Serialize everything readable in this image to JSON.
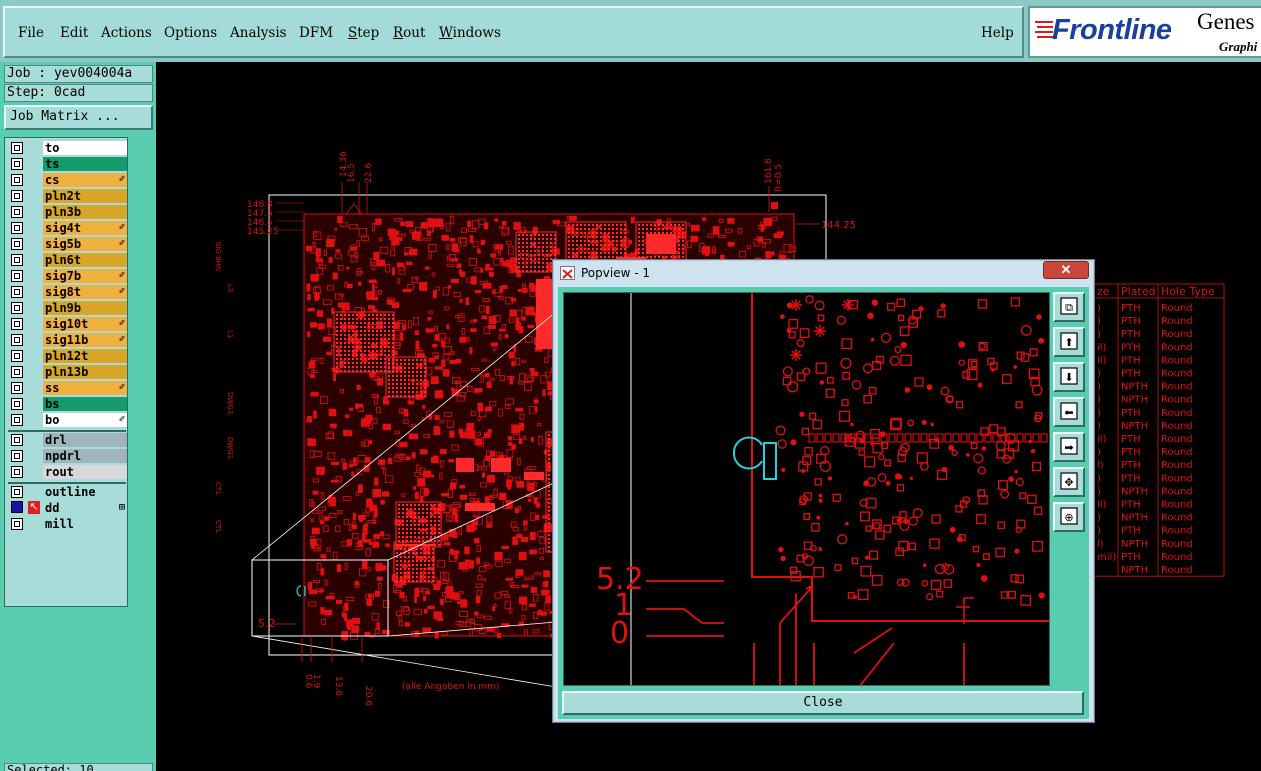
{
  "menubar": {
    "items": [
      "File",
      "Edit",
      "Actions",
      "Options",
      "Analysis",
      "DFM",
      "Step",
      "Rout",
      "Windows"
    ],
    "help": "Help",
    "logo": {
      "brand": "Frontline",
      "product": "Genes",
      "sub": "Graphi"
    }
  },
  "left": {
    "job": "Job : yev004004a",
    "step": "Step: 0cad",
    "job_matrix": "Job Matrix ...",
    "layers": [
      {
        "name": "to",
        "color": "#ffffff",
        "mark": ""
      },
      {
        "name": "ts",
        "color": "#159a6c",
        "mark": ""
      },
      {
        "name": "cs",
        "color": "#f0b040",
        "mark": "✐"
      },
      {
        "name": "pln2t",
        "color": "#d9a62a",
        "mark": ""
      },
      {
        "name": "pln3b",
        "color": "#d9a62a",
        "mark": ""
      },
      {
        "name": "sig4t",
        "color": "#f0b040",
        "mark": "✐"
      },
      {
        "name": "sig5b",
        "color": "#f0b040",
        "mark": "✐"
      },
      {
        "name": "pln6t",
        "color": "#d9a62a",
        "mark": ""
      },
      {
        "name": "sig7b",
        "color": "#f0b040",
        "mark": "✐"
      },
      {
        "name": "sig8t",
        "color": "#f0b040",
        "mark": "✐"
      },
      {
        "name": "pln9b",
        "color": "#d9a62a",
        "mark": ""
      },
      {
        "name": "sig10t",
        "color": "#f0b040",
        "mark": "✐"
      },
      {
        "name": "sig11b",
        "color": "#f0b040",
        "mark": "✐"
      },
      {
        "name": "pln12t",
        "color": "#d9a62a",
        "mark": ""
      },
      {
        "name": "pln13b",
        "color": "#d9a62a",
        "mark": ""
      },
      {
        "name": "ss",
        "color": "#f0b040",
        "mark": "✐"
      },
      {
        "name": "bs",
        "color": "#159a6c",
        "mark": ""
      },
      {
        "name": "bo",
        "color": "#ffffff",
        "mark": "✐"
      }
    ],
    "drill_layers": [
      {
        "name": "drl",
        "color": "#9fb4bc"
      },
      {
        "name": "npdrl",
        "color": "#9fb4bc"
      },
      {
        "name": "rout",
        "color": "#d8d8d8"
      }
    ],
    "misc_layers": [
      {
        "name": "outline",
        "color": "#a8dcd9",
        "mark": ""
      },
      {
        "name": "dd",
        "color": "#a8dcd9",
        "mark": "⊞"
      },
      {
        "name": "mill",
        "color": "#a8dcd9",
        "mark": ""
      }
    ],
    "bottom": "Selected: 10"
  },
  "canvas": {
    "dim_top": [
      "14.36",
      "16.5",
      "22.6",
      "161.8",
      "R=0.5",
      "144.25"
    ],
    "dim_left": [
      "148.8",
      "147.5",
      "146.5",
      "145.25"
    ],
    "dim_bottom": [
      "0.6",
      "1.9",
      "13.6",
      "20.6"
    ],
    "footnote": "(alle Angaben in mm)",
    "side_labels": [
      "SIG 8HN",
      "L3",
      "L1",
      "DWG3",
      "DWG1",
      "CTL",
      "CTL"
    ],
    "board_marker": "5.2",
    "table": {
      "headers": [
        "ze",
        "Plated",
        "Hole Type"
      ],
      "rows": [
        [
          ")",
          "PTH",
          "Round"
        ],
        [
          ")",
          "PTH",
          "Round"
        ],
        [
          ")",
          "PTH",
          "Round"
        ],
        [
          "il)",
          "PTH",
          "Round"
        ],
        [
          "il)",
          "PTH",
          "Round"
        ],
        [
          ")",
          "PTH",
          "Round"
        ],
        [
          ")",
          "NPTH",
          "Round"
        ],
        [
          ")",
          "NPTH",
          "Round"
        ],
        [
          ")",
          "PTH",
          "Round"
        ],
        [
          ")",
          "NPTH",
          "Round"
        ],
        [
          "il)",
          "PTH",
          "Round"
        ],
        [
          ")",
          "PTH",
          "Round"
        ],
        [
          "l)",
          "PTH",
          "Round"
        ],
        [
          ")",
          "PTH",
          "Round"
        ],
        [
          ")",
          "NPTH",
          "Round"
        ],
        [
          "il)",
          "PTH",
          "Round"
        ],
        [
          ")",
          "NPTH",
          "Round"
        ],
        [
          ")",
          "PTH",
          "Round"
        ],
        [
          "l)",
          "NPTH",
          "Round"
        ],
        [
          "mil)",
          "PTH",
          "Round"
        ],
        [
          "",
          "NPTH",
          "Round"
        ]
      ]
    }
  },
  "popview": {
    "title": "Popview - 1",
    "close_x": "✕",
    "close_label": "Close",
    "dims": [
      "5.2",
      "1",
      "0"
    ],
    "tool_icons": [
      "zoom-home-icon",
      "pan-up-icon",
      "pan-down-icon",
      "pan-left-icon",
      "pan-right-icon",
      "zoom-out-icon",
      "zoom-fit-icon"
    ]
  },
  "colors": {
    "board": "#e01010",
    "board_bright": "#ff2a2a",
    "panel": "#59cdb0",
    "menubar": "#a3dbd8"
  }
}
